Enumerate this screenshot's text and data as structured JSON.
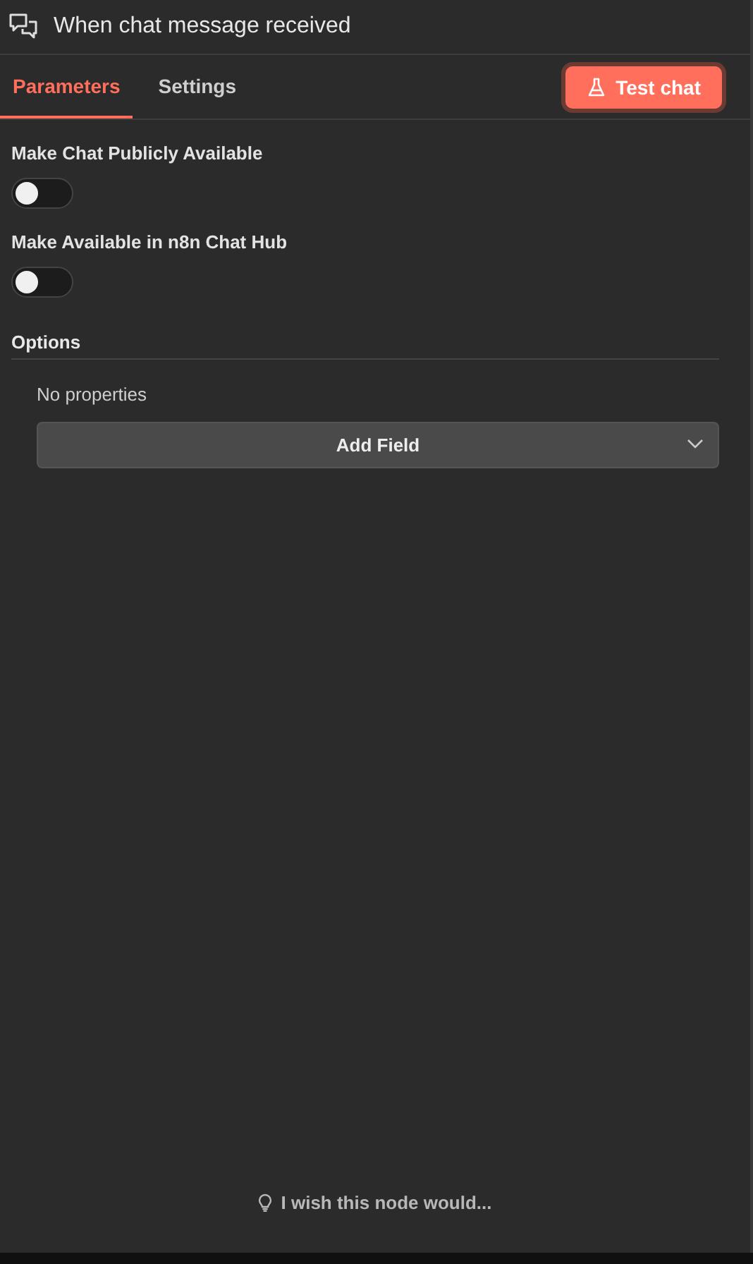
{
  "header": {
    "title": "When chat message received"
  },
  "tabs": [
    {
      "label": "Parameters",
      "selected": true
    },
    {
      "label": "Settings",
      "selected": false
    }
  ],
  "test_button": {
    "label": "Test chat"
  },
  "toggles": [
    {
      "label": "Make Chat Publicly Available",
      "on": false
    },
    {
      "label": "Make Available in n8n Chat Hub",
      "on": false
    }
  ],
  "options": {
    "title": "Options",
    "empty_text": "No properties",
    "add_button": "Add Field"
  },
  "feedback": {
    "label": "I wish this node would..."
  }
}
